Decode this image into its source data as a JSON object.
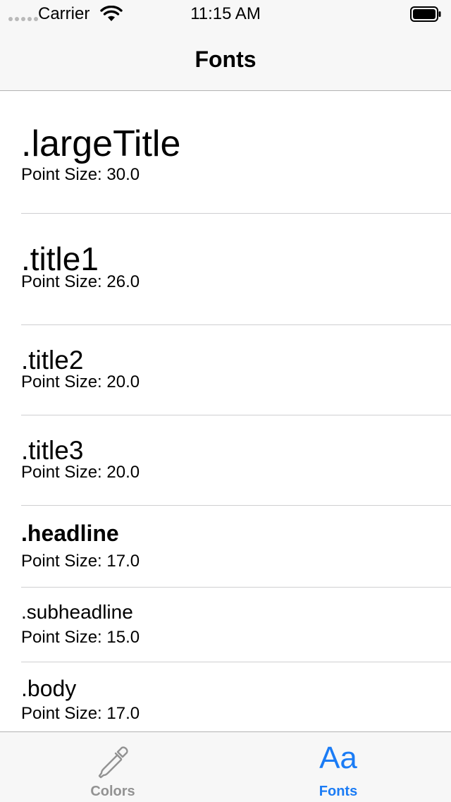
{
  "status_bar": {
    "carrier": "Carrier",
    "time": "11:15 AM"
  },
  "nav_bar": {
    "title": "Fonts"
  },
  "font_styles": [
    {
      "name": ".largeTitle",
      "point_size": "Point Size: 30.0"
    },
    {
      "name": ".title1",
      "point_size": "Point Size: 26.0"
    },
    {
      "name": ".title2",
      "point_size": "Point Size: 20.0"
    },
    {
      "name": ".title3",
      "point_size": "Point Size: 20.0"
    },
    {
      "name": ".headline",
      "point_size": "Point Size: 17.0"
    },
    {
      "name": ".subheadline",
      "point_size": "Point Size: 15.0"
    },
    {
      "name": ".body",
      "point_size": "Point Size: 17.0"
    }
  ],
  "tab_bar": {
    "tabs": [
      {
        "label": "Colors",
        "icon": "eyedropper-icon",
        "selected": false
      },
      {
        "label": "Fonts",
        "icon": "aa-text-icon",
        "glyph": "Aa",
        "selected": true
      }
    ]
  },
  "colors": {
    "tint": "#1b7cf5",
    "inactive_tab": "#929292",
    "bar_background": "#f7f7f7",
    "separator": "#cfcfd1"
  }
}
